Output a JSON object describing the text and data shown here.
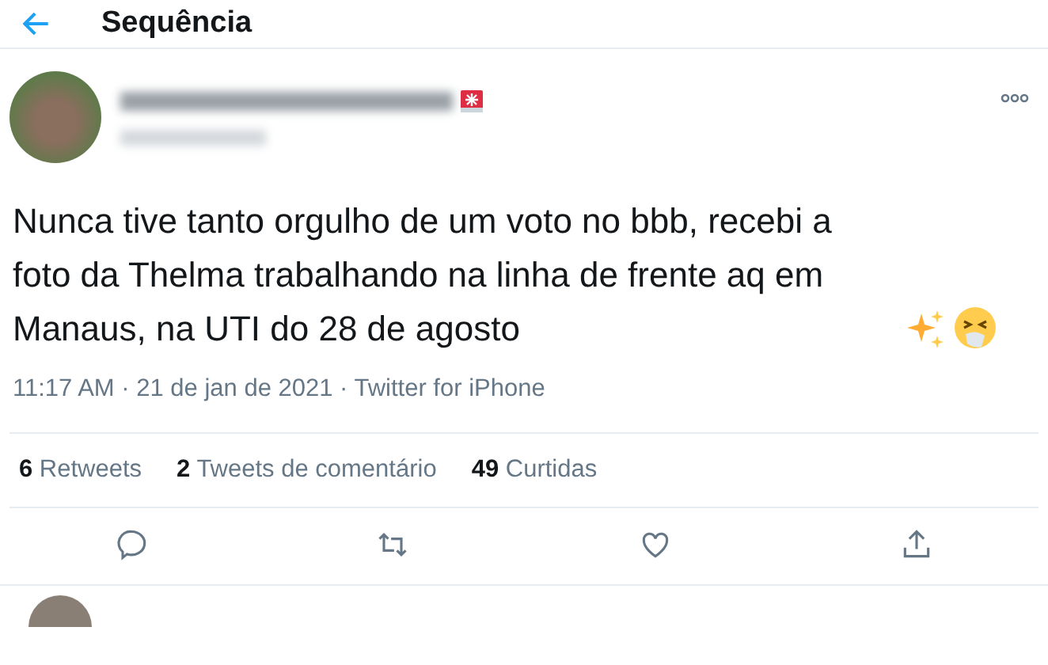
{
  "header": {
    "title": "Sequência"
  },
  "tweet": {
    "text": "Nunca tive tanto orgulho de um voto no bbb, recebi a foto da Thelma trabalhando na linha de frente aq em Manaus, na UTI do 28 de agosto",
    "meta": "11:17 AM · 21 de jan de 2021 · Twitter for iPhone",
    "stats": [
      {
        "count": "6",
        "label": "Retweets"
      },
      {
        "count": "2",
        "label": "Tweets de comentário"
      },
      {
        "count": "49",
        "label": "Curtidas"
      }
    ]
  }
}
